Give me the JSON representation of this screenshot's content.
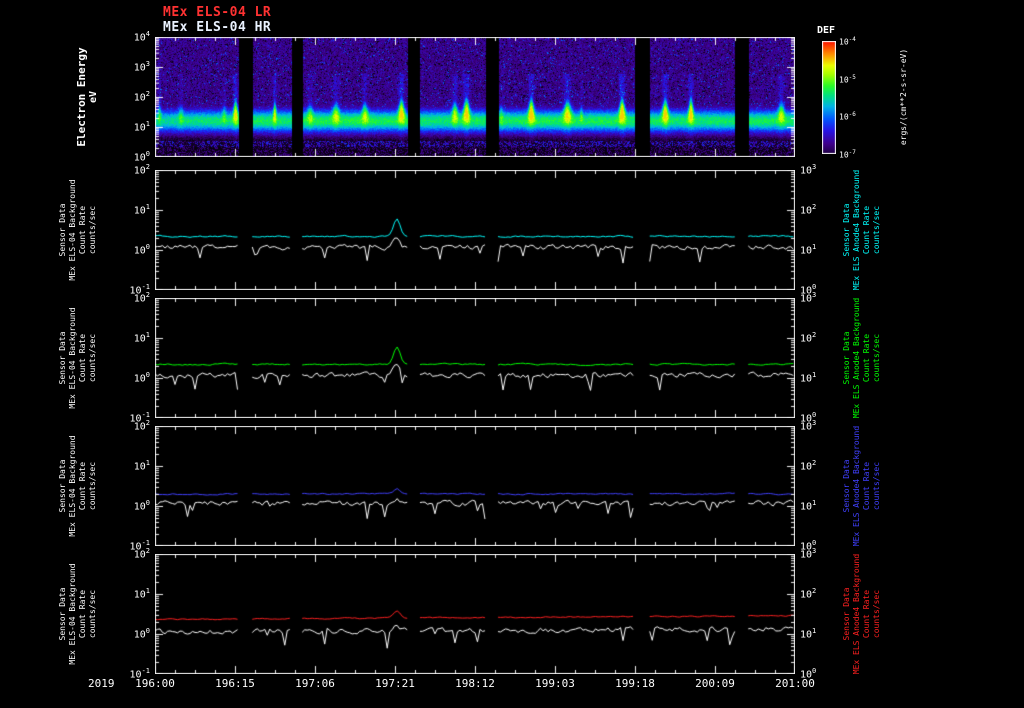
{
  "titles": [
    {
      "label": "MEx ELS-04 LR",
      "color": "#ff3232"
    },
    {
      "label": "MEx ELS-04 HR",
      "color": "#eaf2ff"
    }
  ],
  "chart_data": {
    "type": "heatmap+line",
    "x_axis": {
      "year": "2019",
      "format": "DOY:HH",
      "span_hours": 120,
      "tick_labels": [
        "196:00",
        "196:15",
        "197:06",
        "197:21",
        "198:12",
        "199:03",
        "199:18",
        "200:09",
        "201:00"
      ],
      "minor_ticks_per_major": 4
    },
    "data_gaps_frac": [
      [
        0.13,
        0.152
      ],
      [
        0.214,
        0.23
      ],
      [
        0.395,
        0.414
      ],
      [
        0.516,
        0.536
      ],
      [
        0.75,
        0.773
      ],
      [
        0.906,
        0.927
      ]
    ],
    "spectrogram": {
      "type": "heatmap",
      "ylabel_lines": [
        "Electron Energy",
        "eV"
      ],
      "y_tick_exponents": [
        4,
        3,
        2,
        1,
        0
      ],
      "y_log_range_eV": [
        1,
        10000
      ],
      "main_band": {
        "center_eV": 18,
        "bright_range_eV": [
          6,
          80
        ],
        "flux_level": "high"
      },
      "background": {
        "range_eV": [
          100,
          10000
        ],
        "flux_level": "low"
      },
      "colorbar": {
        "title": "DEF",
        "tick_exponents": [
          -4,
          -5,
          -6,
          -7
        ],
        "log_range": [
          1e-07,
          0.0001
        ],
        "units_label": "ergs/(cm**2-s-sr-eV)"
      }
    },
    "line_panels": [
      {
        "left_label_lines": [
          "Sensor Data",
          "MEx ELS-04 Background",
          "Count Rate",
          "counts/sec"
        ],
        "right_label_lines": [
          "Sensor Data",
          "MEx ELS Anode4 Background",
          "Count Rate",
          "counts/sec"
        ],
        "left_tick_exponents": [
          2,
          1,
          0,
          -1
        ],
        "right_tick_exponents": [
          3,
          2,
          1,
          0
        ],
        "ylim_left": [
          0.1,
          100
        ],
        "ylim_right": [
          1,
          1000
        ],
        "spike_x_frac": 0.378,
        "series": [
          {
            "name": "MEx ELS Anode4 Background Count Rate",
            "color": "#00ffff",
            "base_log10_counts": 0.34,
            "noise_log10": 0.045,
            "spike_amp_log10": 0.42,
            "trend_log10": 0.0
          },
          {
            "name": "MEx ELS-04 Background Count Rate",
            "color": "#ffffff",
            "base_log10_counts": 0.07,
            "noise_log10": 0.1,
            "spike_amp_log10": 0.28,
            "trend_log10": 0.0
          }
        ]
      },
      {
        "left_label_lines": [
          "Sensor Data",
          "MEx ELS-04 Background",
          "Count Rate",
          "counts/sec"
        ],
        "right_label_lines": [
          "Sensor Data",
          "MEx ELS Anode4 Background",
          "Count Rate",
          "counts/sec"
        ],
        "left_tick_exponents": [
          2,
          1,
          0,
          -1
        ],
        "right_tick_exponents": [
          3,
          2,
          1,
          0
        ],
        "ylim_left": [
          0.1,
          100
        ],
        "ylim_right": [
          1,
          1000
        ],
        "spike_x_frac": 0.378,
        "series": [
          {
            "name": "MEx ELS Anode4 Background Count Rate",
            "color": "#00ff00",
            "base_log10_counts": 0.34,
            "noise_log10": 0.045,
            "spike_amp_log10": 0.42,
            "trend_log10": 0.0
          },
          {
            "name": "MEx ELS-04 Background Count Rate",
            "color": "#ffffff",
            "base_log10_counts": 0.07,
            "noise_log10": 0.1,
            "spike_amp_log10": 0.28,
            "trend_log10": 0.0
          }
        ]
      },
      {
        "left_label_lines": [
          "Sensor Data",
          "MEx ELS-04 Background",
          "Count Rate",
          "counts/sec"
        ],
        "right_label_lines": [
          "Sensor Data",
          "MEx ELS Anode4 Background",
          "Count Rate",
          "counts/sec"
        ],
        "left_tick_exponents": [
          2,
          1,
          0,
          -1
        ],
        "right_tick_exponents": [
          3,
          2,
          1,
          0
        ],
        "ylim_left": [
          0.1,
          100
        ],
        "ylim_right": [
          1,
          1000
        ],
        "spike_x_frac": 0.378,
        "series": [
          {
            "name": "MEx ELS Anode4 Background Count Rate",
            "color": "#4040ff",
            "base_log10_counts": 0.3,
            "noise_log10": 0.04,
            "spike_amp_log10": 0.12,
            "trend_log10": 0.0
          },
          {
            "name": "MEx ELS-04 Background Count Rate",
            "color": "#ffffff",
            "base_log10_counts": 0.07,
            "noise_log10": 0.1,
            "spike_amp_log10": 0.1,
            "trend_log10": 0.0
          }
        ]
      },
      {
        "left_label_lines": [
          "Sensor Data",
          "MEx ELS-04 Background",
          "Count Rate",
          "counts/sec"
        ],
        "right_label_lines": [
          "Sensor Data",
          "MEx ELS Anode4 Background",
          "Count Rate",
          "counts/sec"
        ],
        "left_tick_exponents": [
          2,
          1,
          0,
          -1
        ],
        "right_tick_exponents": [
          3,
          2,
          1,
          0
        ],
        "ylim_left": [
          0.1,
          100
        ],
        "ylim_right": [
          1,
          1000
        ],
        "spike_x_frac": 0.378,
        "series": [
          {
            "name": "MEx ELS Anode4 Background Count Rate",
            "color": "#ff2020",
            "base_log10_counts": 0.36,
            "noise_log10": 0.035,
            "spike_amp_log10": 0.18,
            "trend_log10": 0.1
          },
          {
            "name": "MEx ELS-04 Background Count Rate",
            "color": "#ffffff",
            "base_log10_counts": 0.05,
            "noise_log10": 0.1,
            "spike_amp_log10": 0.12,
            "trend_log10": 0.08
          }
        ]
      }
    ]
  }
}
